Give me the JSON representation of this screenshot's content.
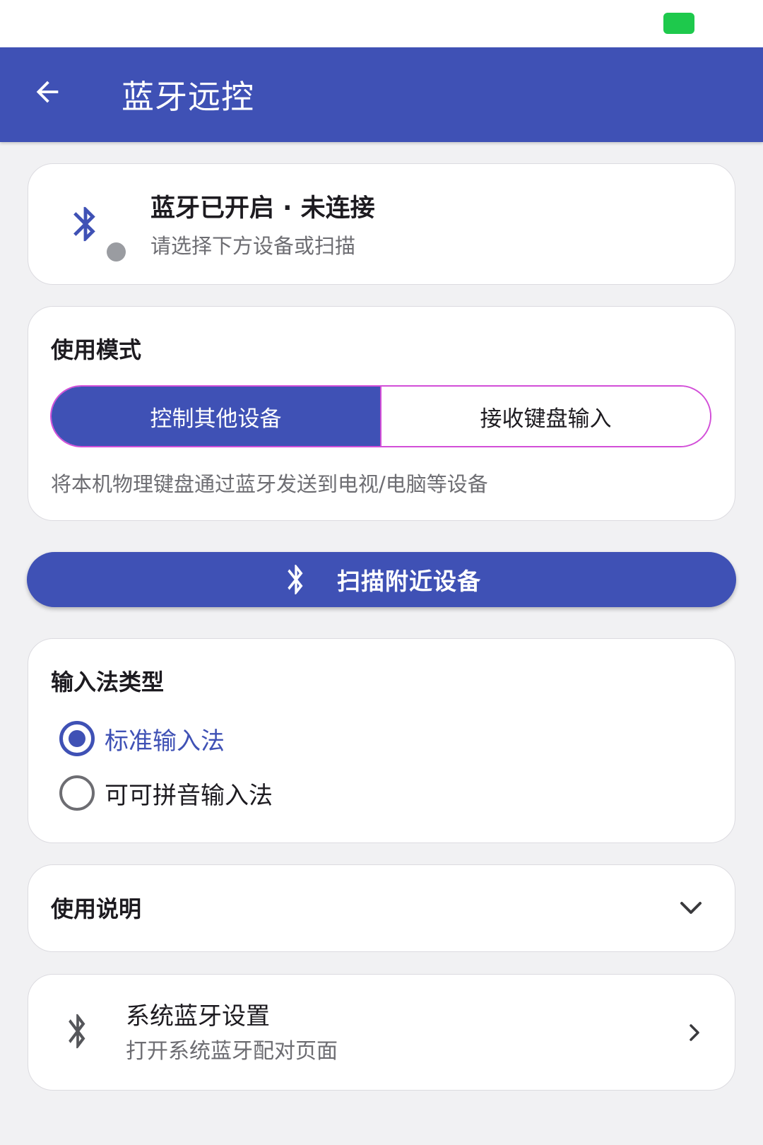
{
  "app_bar": {
    "title": "蓝牙远控",
    "back_icon": "arrow-back-icon",
    "color": "#3f51b5"
  },
  "status_card": {
    "title": "蓝牙已开启 · 未连接",
    "subtitle": "请选择下方设备或扫描",
    "icon": "bluetooth-icon",
    "status_dot_color": "#9a9ca1"
  },
  "mode_card": {
    "title": "使用模式",
    "options": [
      {
        "label": "控制其他设备",
        "selected": true
      },
      {
        "label": "接收键盘输入",
        "selected": false
      }
    ],
    "description": "将本机物理键盘通过蓝牙发送到电视/电脑等设备"
  },
  "scan_button": {
    "label": "扫描附近设备",
    "icon": "bluetooth-icon"
  },
  "ime_card": {
    "title": "输入法类型",
    "options": [
      {
        "label": "标准输入法",
        "selected": true
      },
      {
        "label": "可可拼音输入法",
        "selected": false
      }
    ]
  },
  "help_card": {
    "title": "使用说明",
    "icon": "chevron-down-icon"
  },
  "system_bt_card": {
    "title": "系统蓝牙设置",
    "subtitle": "打开系统蓝牙配对页面",
    "icon": "bluetooth-icon",
    "trailing_icon": "chevron-right-icon"
  },
  "colors": {
    "primary": "#3f51b5",
    "segment_outline": "#d24ed8",
    "battery": "#1ec94c"
  }
}
